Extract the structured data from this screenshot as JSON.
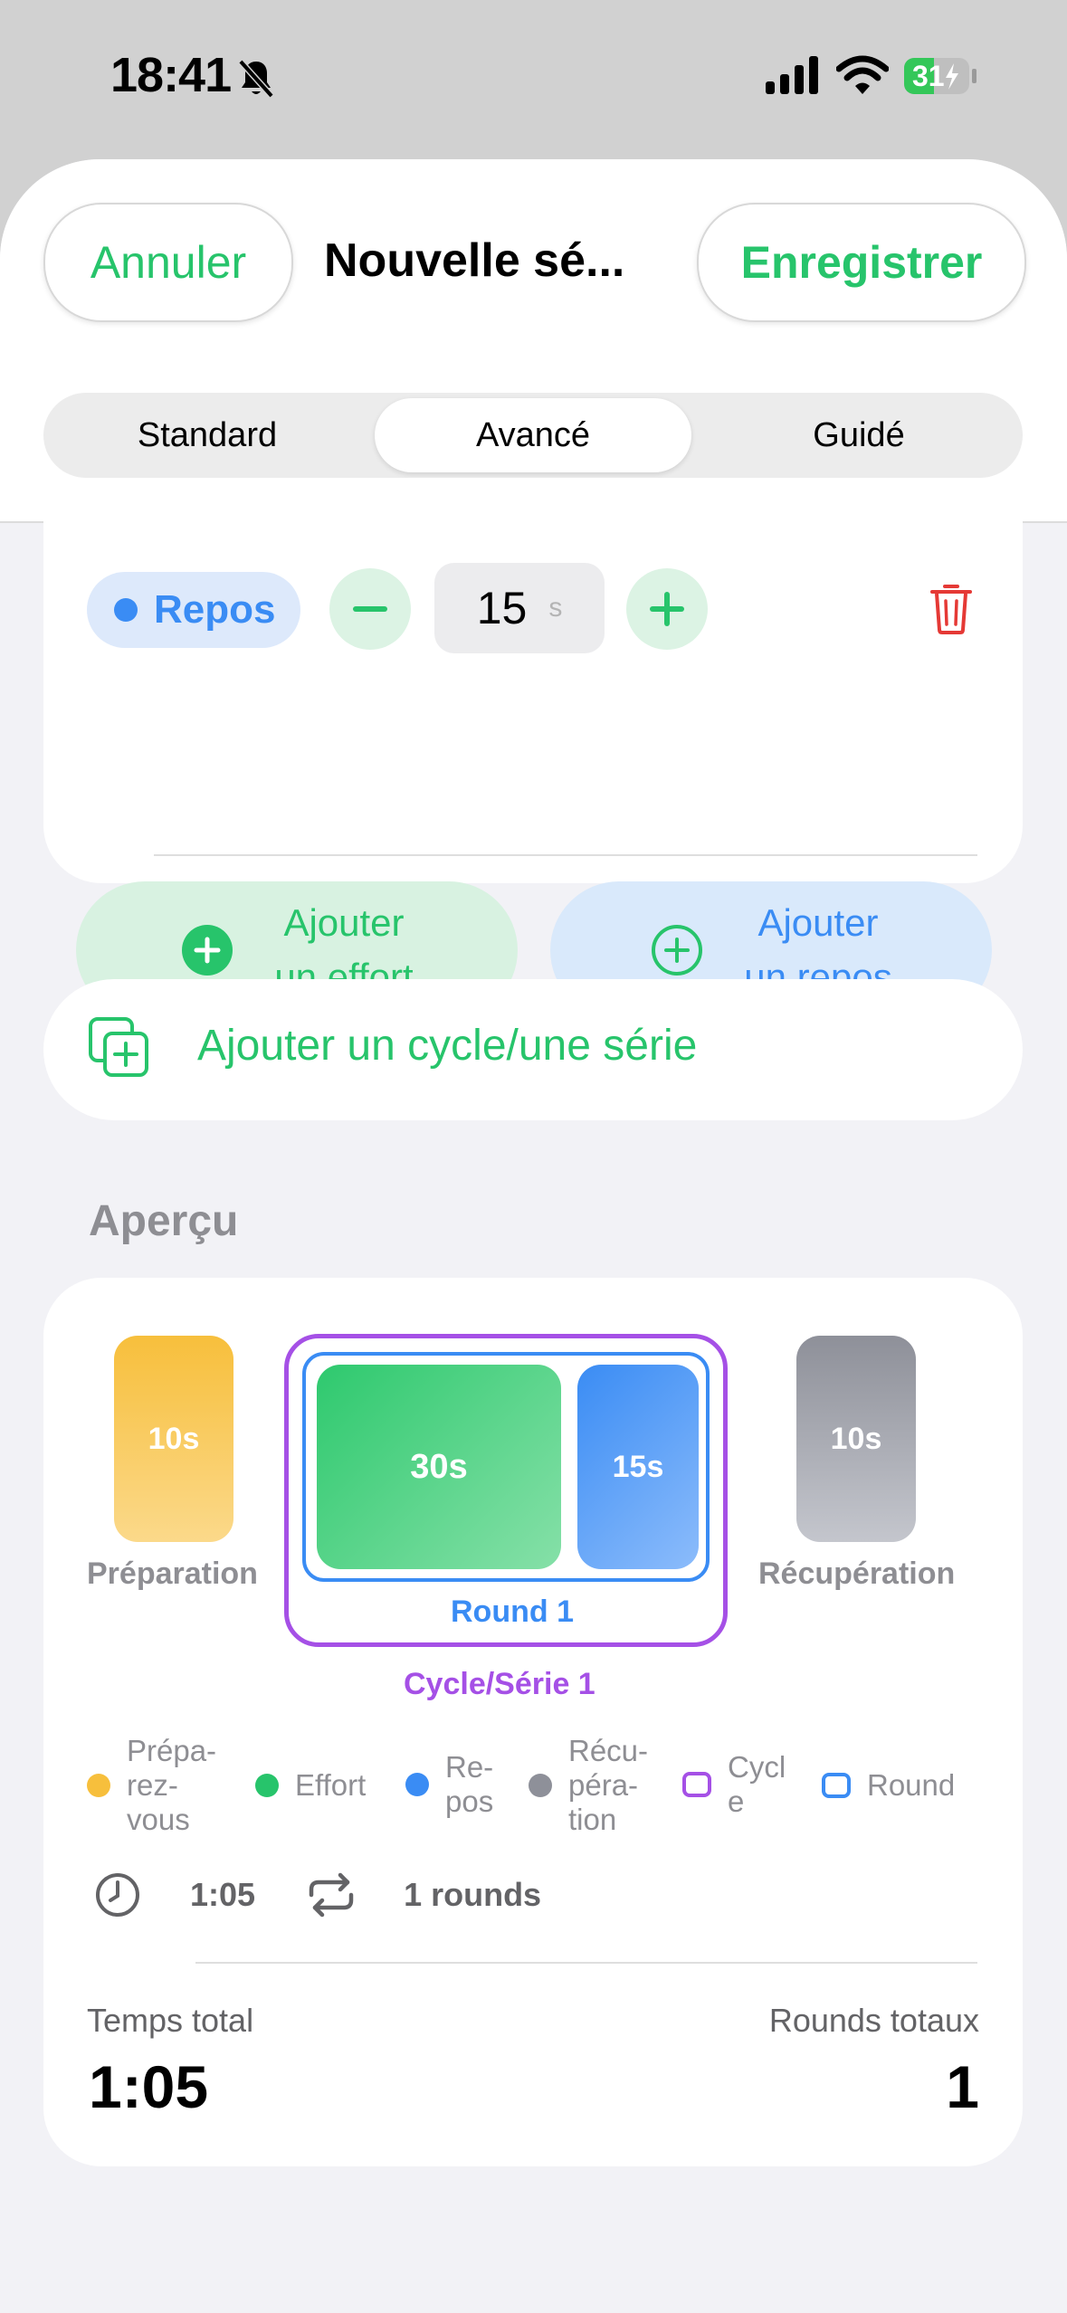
{
  "status_bar": {
    "time": "18:41",
    "battery": "31"
  },
  "header": {
    "cancel_label": "Annuler",
    "title": "Nouvelle sé...",
    "save_label": "Enregistrer",
    "accent_color": "#27c46b"
  },
  "tabs": [
    {
      "label": "Standard",
      "selected": false
    },
    {
      "label": "Avancé",
      "selected": true
    },
    {
      "label": "Guidé",
      "selected": false
    }
  ],
  "interval_row": {
    "type_label": "Repos",
    "value": "15",
    "unit": "s"
  },
  "add_buttons": {
    "effort_line1": "Ajouter",
    "effort_line2": "un effort",
    "rest_line1": "Ajouter",
    "rest_line2": "un repos"
  },
  "add_cycle_label": "Ajouter un cycle/une série",
  "preview": {
    "section_title": "Aperçu",
    "prep": {
      "duration": "10s",
      "label": "Préparation"
    },
    "effort": {
      "duration": "30s"
    },
    "rest": {
      "duration": "15s"
    },
    "recovery": {
      "duration": "10s",
      "label": "Récupération"
    },
    "round_label": "Round 1",
    "cycle_label": "Cycle/Série 1",
    "legend": {
      "prep_l1": "Prépa-",
      "prep_l2": "rez-",
      "prep_l3": "vous",
      "effort": "Effort",
      "rest_l1": "Re-",
      "rest_l2": "pos",
      "recov_l1": "Récu-",
      "recov_l2": "péra-",
      "recov_l3": "tion",
      "cycle_l1": "Cycl",
      "cycle_l2": "e",
      "round": "Round"
    },
    "duration": "1:05",
    "rounds": "1 rounds",
    "total_time_label": "Temps total",
    "total_time": "1:05",
    "total_rounds_label": "Rounds totaux",
    "total_rounds": "1"
  }
}
